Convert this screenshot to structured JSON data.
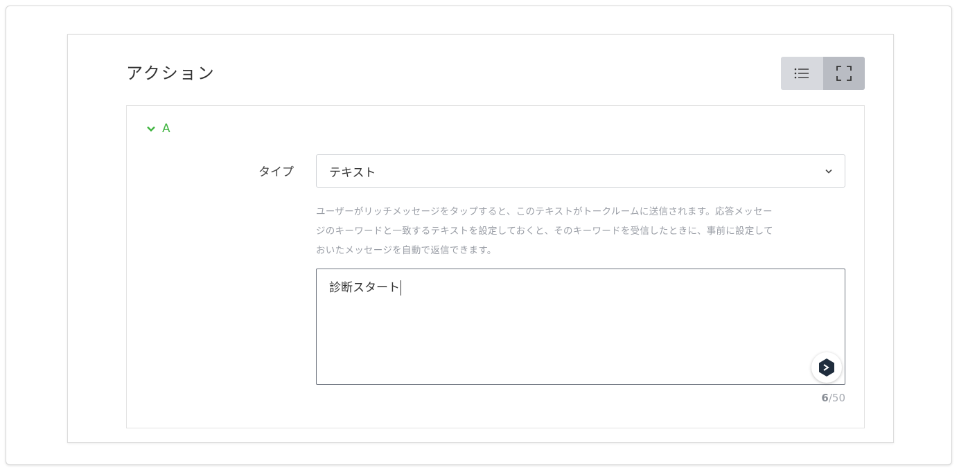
{
  "header": {
    "title": "アクション"
  },
  "view_toggle": {
    "list_icon": "list-icon",
    "fullscreen_icon": "fullscreen-icon",
    "active": "fullscreen"
  },
  "action": {
    "label": "A",
    "type_label": "タイプ",
    "type_value": "テキスト",
    "help_text": "ユーザーがリッチメッセージをタップすると、このテキストがトークルームに送信されます。応答メッセー\nジのキーワードと一致するテキストを設定しておくと、そのキーワードを受信したときに、事前に設定して\nおいたメッセージを自動で返信できます。",
    "text_value": "診断スタート",
    "count_current": "6",
    "count_max": "/50"
  },
  "colors": {
    "accent_green": "#3fb43f",
    "toggle_bg": "#d7d9de",
    "toggle_active": "#b9bcc3"
  }
}
